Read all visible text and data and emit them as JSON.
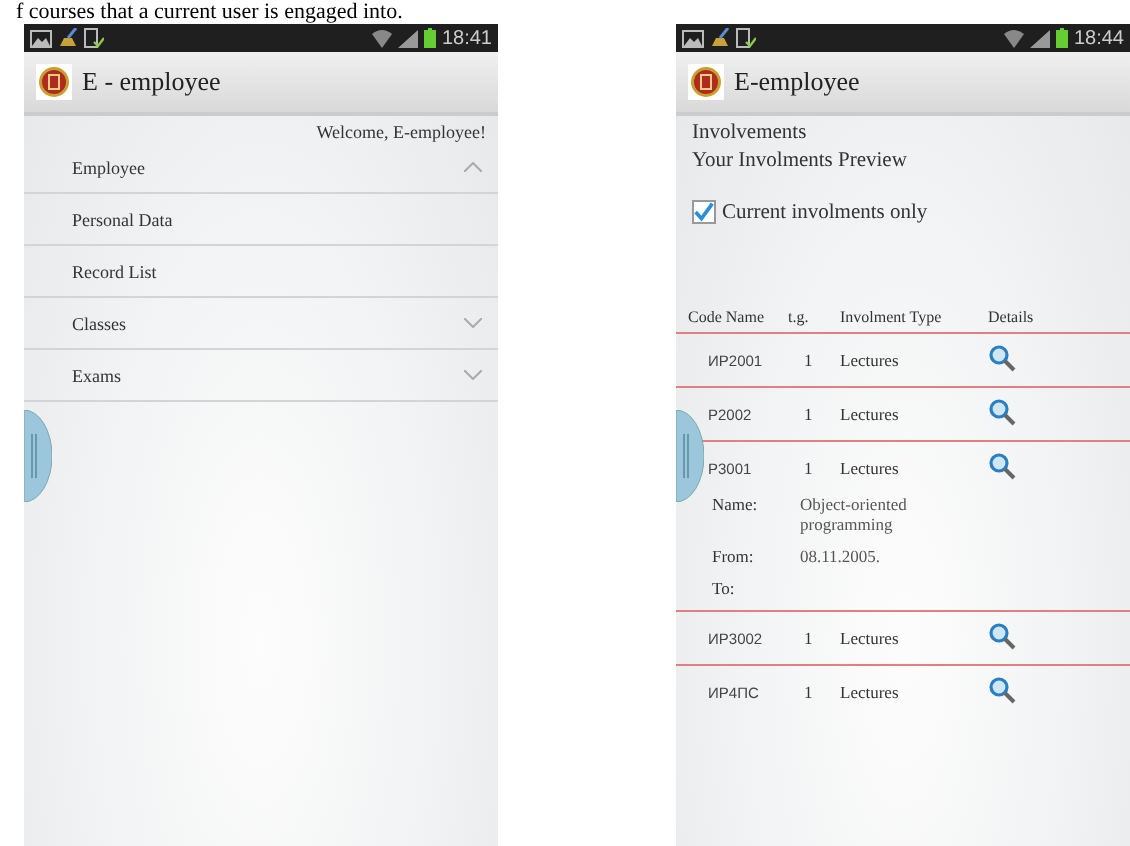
{
  "caption": "f courses that a current user is engaged into.",
  "menu_screen": {
    "status_bar": {
      "time": "18:41"
    },
    "app_bar": {
      "title": "E - employee"
    },
    "welcome": "Welcome, E-employee!",
    "menu": [
      {
        "label": "Employee",
        "expanded": true,
        "children": [
          {
            "label": "Personal Data"
          },
          {
            "label": "Record List"
          }
        ]
      },
      {
        "label": "Classes",
        "expanded": false
      },
      {
        "label": "Exams",
        "expanded": false
      }
    ]
  },
  "involvements_screen": {
    "status_bar": {
      "time": "18:44"
    },
    "app_bar": {
      "title": "E-employee"
    },
    "title": "Involvements",
    "subtitle": "Your Involments Preview",
    "filter": {
      "label": "Current involments only",
      "checked": true
    },
    "table": {
      "columns": [
        "Code Name",
        "t.g.",
        "Involment Type",
        "Details"
      ],
      "rows": [
        {
          "code": "ИР2001",
          "group": "1",
          "type": "Lectures"
        },
        {
          "code": "P2002",
          "group": "1",
          "type": "Lectures"
        },
        {
          "code": "P3001",
          "group": "1",
          "type": "Lectures",
          "details": [
            {
              "label": "Name:",
              "value": "Object-oriented programming"
            },
            {
              "label": "From:",
              "value": "08.11.2005."
            },
            {
              "label": "To:"
            }
          ]
        },
        {
          "code": "ИР3002",
          "group": "1",
          "type": "Lectures"
        },
        {
          "code": "ИР4ПС",
          "group": "1",
          "type": "Lectures"
        }
      ]
    }
  }
}
